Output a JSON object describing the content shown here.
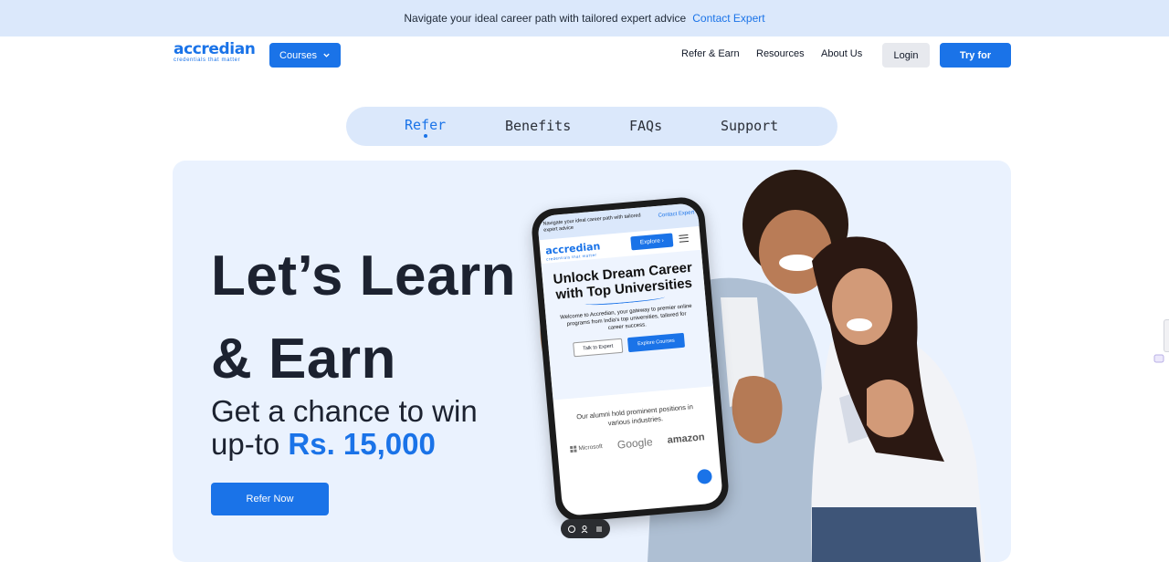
{
  "announcement": {
    "text": "Navigate your ideal career path with tailored expert advice",
    "link": "Contact Expert"
  },
  "nav": {
    "logo": "accredian",
    "logo_tagline": "credentials that matter",
    "courses_label": "Courses",
    "links": [
      "Refer & Earn",
      "Resources",
      "About Us"
    ],
    "login_label": "Login",
    "try_label": "Try for"
  },
  "tabs": [
    "Refer",
    "Benefits",
    "FAQs",
    "Support"
  ],
  "hero": {
    "headline_1": "Let’s Learn",
    "headline_2": "& Earn",
    "sub_1": "Get a chance to win",
    "sub_2": "up-to",
    "amount": "Rs. 15,000",
    "cta": "Refer Now"
  },
  "phone": {
    "top_text": "Navigate your ideal career path with tailored expert advice",
    "top_link": "Contact Expert",
    "logo": "accredian",
    "logo_tagline": "credentials that matter",
    "explore": "Explore",
    "title": "Unlock Dream Career with Top Universities",
    "desc": "Welcome to Accredian, your gateway to premier online programs from India's top universities, tailored for career success.",
    "talk_btn": "Talk to Expert",
    "explore_btn": "Explore Courses",
    "alumni": "Our alumni hold prominent positions in various industries.",
    "brands": [
      "Microsoft",
      "Google",
      "amazon"
    ]
  },
  "colors": {
    "accent": "#1a73e8",
    "banner_bg": "#dbe8fb",
    "hero_bg": "#eaf2fe",
    "heading": "#1c2230"
  }
}
